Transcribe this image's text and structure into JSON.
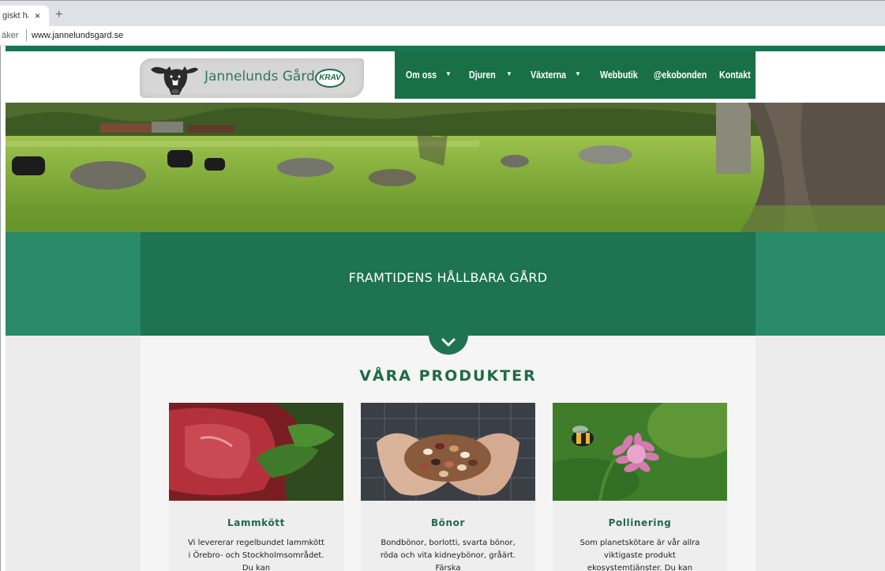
{
  "browser": {
    "tab_title": "giskt hål",
    "tab_close": "×",
    "new_tab": "+",
    "security_label": "äker",
    "url": "www.jannelundsgard.se"
  },
  "header": {
    "logo_text": "Jannelunds Gård",
    "krav_label": "KRAV",
    "nav": [
      {
        "label": "Om oss",
        "has_dropdown": true
      },
      {
        "label": "Djuren",
        "has_dropdown": true
      },
      {
        "label": "Växterna",
        "has_dropdown": true
      },
      {
        "label": "Webbutik",
        "has_dropdown": false
      },
      {
        "label": "@ekobonden",
        "has_dropdown": false
      },
      {
        "label": "Kontakt",
        "has_dropdown": false
      }
    ]
  },
  "tagline": "FRAMTIDENS HÅLLBARA GÅRD",
  "products": {
    "title": "VÅRA PRODUKTER",
    "cards": [
      {
        "title": "Lammkött",
        "text": "Vi levererar regelbundet lammkött i Örebro- och Stockholmsområdet. Du kan"
      },
      {
        "title": "Bönor",
        "text": "Bondbönor, borlotti, svarta bönor, röda och vita kidneybönor, gråärt. Färska"
      },
      {
        "title": "Pollinering",
        "text": "Som planetskötare är vår allra viktigaste produkt ekosystemtjänster. Du kan"
      }
    ]
  },
  "colors": {
    "brand_green": "#1a7046",
    "band_green": "#288a68",
    "title_green": "#1e6b47"
  },
  "icons": [
    "cow-logo-icon",
    "krav-badge-icon",
    "chevron-down-icon",
    "caret-down-icon"
  ]
}
